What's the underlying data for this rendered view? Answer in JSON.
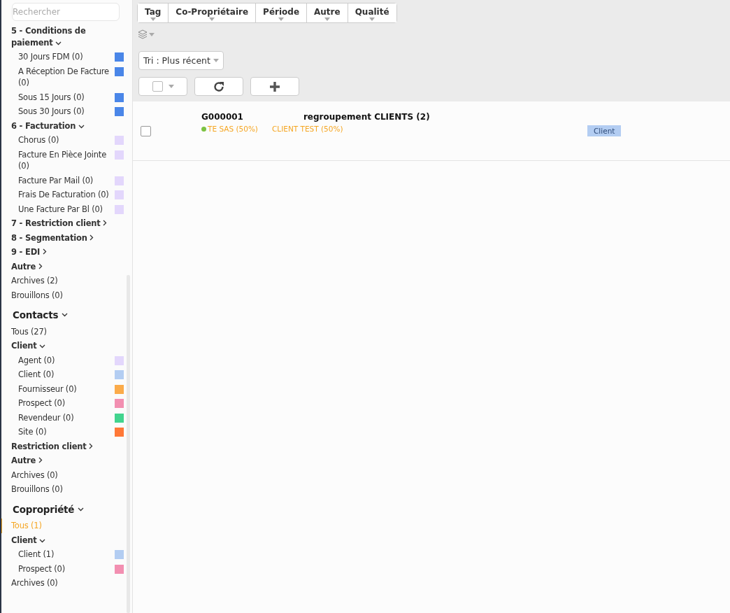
{
  "sidebar": {
    "search": {
      "placeholder": "Rechercher"
    },
    "tree": [
      {
        "kind": "group",
        "label": "5 - Conditions de paiement",
        "expanded": true,
        "children": [
          {
            "kind": "item",
            "label": "30 Jours FDM (0)",
            "color": "#4a86e8",
            "selected": false
          },
          {
            "kind": "item",
            "label": "A Réception De Facture (0)",
            "color": "#4a86e8",
            "selected": false
          },
          {
            "kind": "item",
            "label": "Sous 15 Jours (0)",
            "color": "#4a86e8",
            "selected": false
          },
          {
            "kind": "item",
            "label": "Sous 30 Jours (0)",
            "color": "#4a86e8",
            "selected": false
          }
        ]
      },
      {
        "kind": "group",
        "label": "6 - Facturation",
        "expanded": true,
        "children": [
          {
            "kind": "item",
            "label": "Chorus (0)",
            "color": "#e3d7fc",
            "selected": false
          },
          {
            "kind": "item",
            "label": "Facture En Pièce Jointe (0)",
            "color": "#e3d7fc",
            "selected": false
          },
          {
            "kind": "item",
            "label": "Facture Par Mail (0)",
            "color": "#e3d7fc",
            "selected": false
          },
          {
            "kind": "item",
            "label": "Frais De Facturation (0)",
            "color": "#e3d7fc",
            "selected": false
          },
          {
            "kind": "item",
            "label": "Une Facture Par Bl (0)",
            "color": "#e3d7fc",
            "selected": false
          }
        ]
      },
      {
        "kind": "group",
        "label": "7 - Restriction client",
        "expanded": false
      },
      {
        "kind": "group",
        "label": "8 - Segmentation",
        "expanded": false
      },
      {
        "kind": "group",
        "label": "9 - EDI",
        "expanded": false
      },
      {
        "kind": "group",
        "label": "Autre",
        "expanded": false
      },
      {
        "kind": "entry",
        "label": "Archives (2)",
        "selected": false
      },
      {
        "kind": "entry",
        "label": "Brouillons (0)",
        "selected": false
      },
      {
        "kind": "section",
        "label": "Contacts",
        "expanded": true,
        "children": [
          {
            "kind": "entry",
            "label": "Tous (27)",
            "selected": false
          },
          {
            "kind": "group",
            "label": "Client",
            "expanded": true,
            "children": [
              {
                "kind": "item",
                "label": "Agent (0)",
                "color": "#e3d7fc",
                "selected": false
              },
              {
                "kind": "item",
                "label": "Client (0)",
                "color": "#b3cdf2",
                "selected": false
              },
              {
                "kind": "item",
                "label": "Fournisseur (0)",
                "color": "#fbab4a",
                "selected": false
              },
              {
                "kind": "item",
                "label": "Prospect (0)",
                "color": "#f28fb1",
                "selected": false
              },
              {
                "kind": "item",
                "label": "Revendeur (0)",
                "color": "#42d48e",
                "selected": false
              },
              {
                "kind": "item",
                "label": "Site (0)",
                "color": "#ff7837",
                "selected": false
              }
            ]
          },
          {
            "kind": "group",
            "label": "Restriction client",
            "expanded": false
          },
          {
            "kind": "group",
            "label": "Autre",
            "expanded": false
          },
          {
            "kind": "entry",
            "label": "Archives (0)",
            "selected": false
          },
          {
            "kind": "entry",
            "label": "Brouillons (0)",
            "selected": false
          }
        ]
      },
      {
        "kind": "section",
        "label": "Copropriété",
        "expanded": true,
        "children": [
          {
            "kind": "entry",
            "label": "Tous (1)",
            "selected": true
          },
          {
            "kind": "group",
            "label": "Client",
            "expanded": true,
            "children": [
              {
                "kind": "item",
                "label": "Client (1)",
                "color": "#b3cdf2",
                "selected": false
              },
              {
                "kind": "item",
                "label": "Prospect (0)",
                "color": "#f28fb1",
                "selected": false
              }
            ]
          },
          {
            "kind": "entry",
            "label": "Archives (0)",
            "selected": false
          }
        ]
      }
    ]
  },
  "filters": [
    "Tag",
    "Co-Propriétaire",
    "Période",
    "Autre",
    "Qualité"
  ],
  "sort": {
    "label": "Tri : Plus récent"
  },
  "rows": [
    {
      "checked": false,
      "code": "G000001",
      "title": "regroupement CLIENTS (2)",
      "owners": [
        {
          "name": "TE SAS (50%)",
          "dot": true
        },
        {
          "name": "CLIENT TEST (50%)",
          "dot": false
        }
      ],
      "tag": "Client"
    }
  ]
}
